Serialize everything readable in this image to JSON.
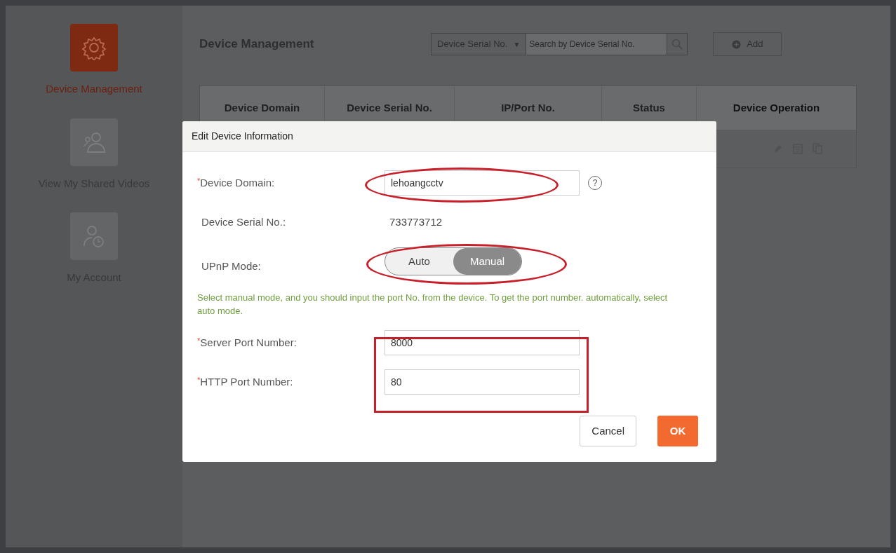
{
  "sidebar": {
    "items": [
      {
        "label": "Device Management",
        "selected": true,
        "kind": "gear"
      },
      {
        "label": "View My Shared Videos",
        "selected": false,
        "kind": "share"
      },
      {
        "label": "My Account",
        "selected": false,
        "kind": "account"
      }
    ]
  },
  "main": {
    "title": "Device Management",
    "search_type": "Device Serial No.",
    "search_dropdown_icon": "▼",
    "search_placeholder": "Search by Device Serial No.",
    "add_button": "Add",
    "table": {
      "columns": [
        "Device Domain",
        "Device Serial No.",
        "IP/Port No.",
        "Status",
        "Device Operation"
      ]
    }
  },
  "dialog": {
    "title": "Edit Device Information",
    "device_domain": {
      "label": "Device Domain:",
      "required_mark": "*",
      "value": "lehoangcctv",
      "help_icon": "?"
    },
    "serial": {
      "label": "Device Serial No.:",
      "value": "733773712"
    },
    "upnp": {
      "label": "UPnP Mode:",
      "options": [
        {
          "label": "Auto",
          "selected": false
        },
        {
          "label": "Manual",
          "selected": true
        }
      ]
    },
    "note": "Select manual mode, and you should input the port No. from the device. To get the port number. automatically, select auto mode.",
    "server_port": {
      "label": "Server Port Number:",
      "required_mark": "*",
      "value": "8000"
    },
    "http_port": {
      "label": "HTTP Port Number:",
      "required_mark": "*",
      "value": "80"
    },
    "buttons": {
      "cancel": "Cancel",
      "ok": "OK"
    }
  }
}
